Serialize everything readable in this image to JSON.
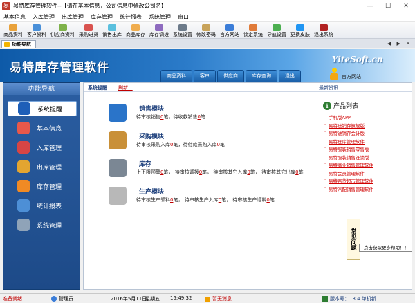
{
  "window": {
    "title": "易特库存管理软件--【请在基本信息，公司信息中修改公司名】",
    "min": "—",
    "max": "☐",
    "close": "✕"
  },
  "menu": [
    "基本信息",
    "入库管理",
    "出库管理",
    "库存管理",
    "统计报表",
    "系统管理",
    "窗口"
  ],
  "toolbar": [
    {
      "label": "商品资料",
      "color": "#e9a23b"
    },
    {
      "label": "客户资料",
      "color": "#4a90d9"
    },
    {
      "label": "供应商资料",
      "color": "#7fb24a"
    },
    {
      "label": "采购进货",
      "color": "#d9534f"
    },
    {
      "label": "销售出库",
      "color": "#5bc0de"
    },
    {
      "label": "商品库存",
      "color": "#f0ad4e"
    },
    {
      "label": "库存调拨",
      "color": "#8e6bbf"
    },
    {
      "label": "系统设置",
      "color": "#6c7a89"
    },
    {
      "label": "修改密码",
      "color": "#c8a35a"
    },
    {
      "label": "官方网站",
      "color": "#3b7dd8"
    },
    {
      "label": "锁定系统",
      "color": "#e07b39"
    },
    {
      "label": "导航设置",
      "color": "#4caf50"
    },
    {
      "label": "更换皮肤",
      "color": "#2196f3"
    },
    {
      "label": "退出系统",
      "color": "#b22222"
    }
  ],
  "tabstrip": {
    "active": "功能导航",
    "nav": "◀ ▶ ✕"
  },
  "banner": {
    "title": "易特库存管理软件",
    "brand": "YiteSoft.cn",
    "tabs": [
      "商品资料",
      "客户",
      "供应商",
      "库存查询",
      "退出"
    ],
    "official": "官方网站"
  },
  "leftnav": {
    "title": "功能导航",
    "items": [
      {
        "label": "系统提醒",
        "color": "#1e5fb8"
      },
      {
        "label": "基本信息",
        "color": "#e8584a"
      },
      {
        "label": "入库管理",
        "color": "#d64545"
      },
      {
        "label": "出库管理",
        "color": "#e3a530"
      },
      {
        "label": "库存管理",
        "color": "#f08a24"
      },
      {
        "label": "统计报表",
        "color": "#4d8fd6"
      },
      {
        "label": "系统管理",
        "color": "#8fa3b8"
      }
    ]
  },
  "content": {
    "remind": "系统提醒",
    "refresh": "刷新...",
    "latest": "最新资讯",
    "modules": [
      {
        "title": "销售模块",
        "icon_color": "#2a74c9",
        "parts": [
          "待审核销售",
          "0",
          "笔，待收款销售",
          "0",
          "笔"
        ]
      },
      {
        "title": "采购模块",
        "icon_color": "#c99038",
        "parts": [
          "待审核采购入库",
          "0",
          "笔，待付款采购入库",
          "0",
          "笔"
        ]
      },
      {
        "title": "库存",
        "icon_color": "#7b8794",
        "parts": [
          "上下限预警",
          "0",
          "笔，  待审核调拨",
          "0",
          "笔，  待审核其它入库",
          "0",
          "笔，  待审核其它出库",
          "0",
          "笔"
        ]
      },
      {
        "title": "生产模块",
        "icon_color": "#b8b8b8",
        "parts": [
          "待审核生产领料",
          "0",
          "笔，  待审核生产入库",
          "0",
          "笔，  待审核生产退料",
          "0",
          "笔"
        ]
      }
    ]
  },
  "products": {
    "title": "产品列表",
    "items": [
      "手机版APP",
      "易特进销存旗舰版",
      "易特进销存会计版",
      "易特仓库管理软件",
      "易特服装销售零售版",
      "易特服装销售连锁版",
      "易特商业销售管理软件",
      "易特会员管理软件",
      "易特百货超市管理软件",
      "易特汽配销售管理软件"
    ]
  },
  "faq": {
    "label": "常见问题",
    "tooltip": "点击获取更多帮助！！"
  },
  "status": {
    "ready": "准备就绪",
    "user": "管理员",
    "date": "2016年5月11日",
    "week": "星期五",
    "time": "15:49:32",
    "msg": "暂无消息",
    "version": "版本号：13.4 单机新"
  }
}
